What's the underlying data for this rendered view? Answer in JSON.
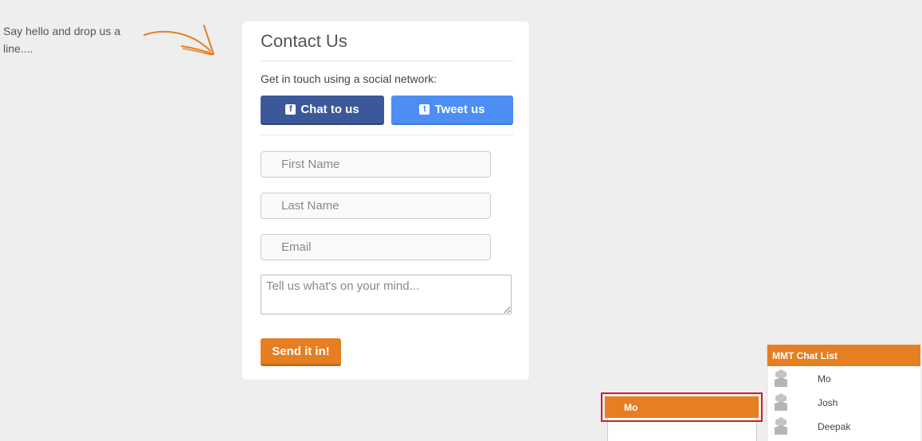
{
  "intro": {
    "text": "Say hello and drop us a line...."
  },
  "contact": {
    "title": "Contact Us",
    "social_caption": "Get in touch using a social network:",
    "facebook_label": "Chat to us",
    "twitter_label": "Tweet us",
    "first_name_placeholder": "First Name",
    "last_name_placeholder": "Last Name",
    "email_placeholder": "Email",
    "message_placeholder": "Tell us what's on your mind...",
    "submit_label": "Send it in!"
  },
  "chat_window": {
    "title": "Mo"
  },
  "chat_list": {
    "title": "MMT Chat List",
    "users": [
      {
        "name": "Mo",
        "icon": "user-icon"
      },
      {
        "name": "Josh",
        "icon": "user-icon"
      },
      {
        "name": "Deepak",
        "icon": "user-icon"
      }
    ]
  },
  "colors": {
    "accent": "#e67e22",
    "facebook": "#3b5998",
    "twitter": "#4d8ef5",
    "highlight_border": "#d21c2b",
    "background": "#eeeeee"
  }
}
